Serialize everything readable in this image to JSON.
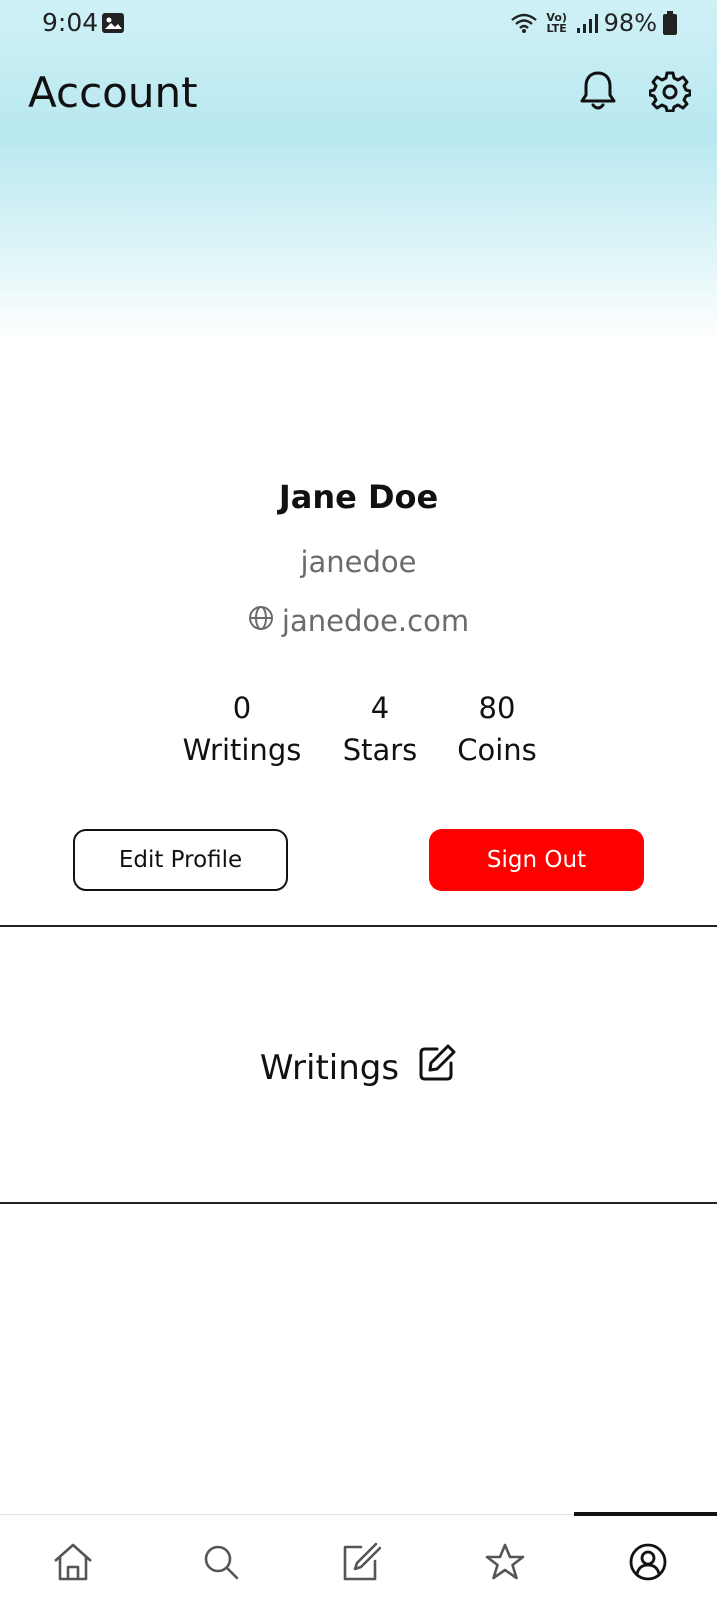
{
  "status_bar": {
    "time": "9:04",
    "network_label": "Vo) LTE",
    "battery": "98%"
  },
  "header": {
    "title": "Account",
    "icons": [
      "bell-icon",
      "gear-icon"
    ]
  },
  "profile": {
    "name": "Jane Doe",
    "username": "janedoe",
    "website": "janedoe.com"
  },
  "stats": {
    "writings": {
      "value": "0",
      "label": "Writings"
    },
    "stars": {
      "value": "4",
      "label": "Stars"
    },
    "coins": {
      "value": "80",
      "label": "Coins"
    }
  },
  "actions": {
    "edit_profile": "Edit Profile",
    "sign_out": "Sign Out"
  },
  "writings_section": {
    "label": "Writings"
  },
  "bottom_nav": {
    "items": [
      "home-icon",
      "search-icon",
      "compose-icon",
      "star-icon",
      "account-icon"
    ],
    "active": "account"
  },
  "colors": {
    "sign_out_background": "#ff0000",
    "header_gradient_top": "#cff1f6"
  }
}
